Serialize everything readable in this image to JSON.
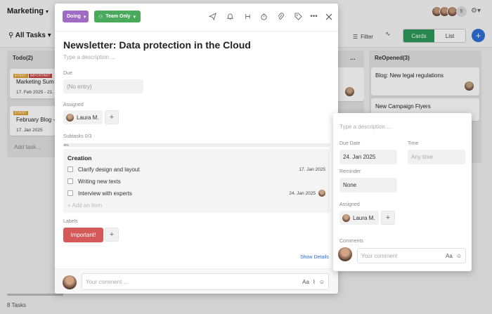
{
  "workspace": {
    "title": "Marketing",
    "more_members": "5"
  },
  "view": {
    "filter_label": "All Tasks",
    "filter_button": "Filter",
    "cards_label": "Cards",
    "list_label": "List"
  },
  "columns": {
    "todo": {
      "title": "Todo(2)",
      "cards": [
        {
          "tags": [
            "EVENT",
            "IMPORTANT"
          ],
          "title": "Marketing Sum",
          "date": "17. Feb 2025 - 21."
        },
        {
          "tags": [
            "EVENT"
          ],
          "title": "February Blog -",
          "date": "17. Jan 2025"
        }
      ],
      "add_task": "Add task..."
    },
    "reopened": {
      "title": "ReOpened(3)",
      "cards": [
        {
          "title": "Blog: New legal regulations"
        },
        {
          "title": "New Campaign Flyers"
        }
      ]
    }
  },
  "footer": {
    "tasks_count": "8 Tasks"
  },
  "modal": {
    "status": "Doing",
    "visibility": "Team Only",
    "title": "Newsletter: Data protection in the Cloud",
    "description_placeholder": "Type a description ...",
    "due_label": "Due",
    "due_value": "(No entry)",
    "assigned_label": "Assigned",
    "assignee": "Laura M.",
    "subtasks_label": "Subtasks 0/3",
    "progress_text": "0%",
    "progress": 0,
    "subtask_group": "Creation",
    "subtasks": [
      {
        "text": "Clarify design and layout",
        "date": "17. Jan 2025"
      },
      {
        "text": "Writing new texts",
        "date": ""
      },
      {
        "text": "Interview with experts",
        "date": "24. Jan 2025"
      }
    ],
    "add_item": "Add an item",
    "labels_label": "Labels",
    "label_chip": "Important!",
    "show_details": "Show Details",
    "comment_placeholder": "Your comment ...",
    "aa": "Aa"
  },
  "details": {
    "description_placeholder": "Type a description ...",
    "due_date_label": "Due Date",
    "due_date_value": "24. Jan 2025",
    "time_label": "Time",
    "time_placeholder": "Any time",
    "reminder_label": "Reminder",
    "reminder_value": "None",
    "assigned_label": "Assigned",
    "assignee": "Laura M.",
    "comments_label": "Comments",
    "comment_placeholder": "Your comment",
    "aa": "Aa"
  },
  "colors": {
    "doing": "#a06bc4",
    "team": "#4aaa5c",
    "important": "#d6595a",
    "cards_active": "#2e9a5a",
    "add_button": "#2f6fd6"
  }
}
